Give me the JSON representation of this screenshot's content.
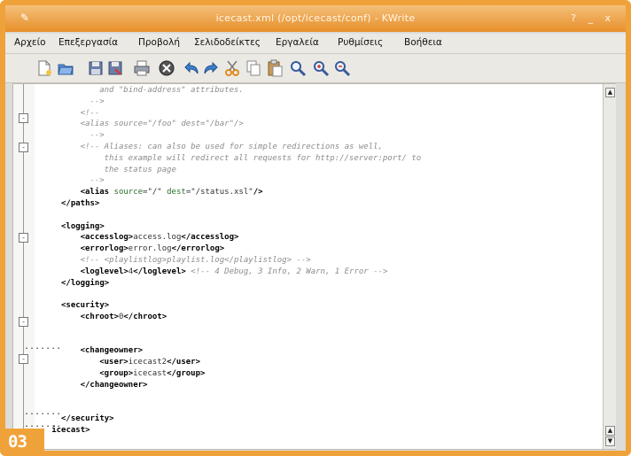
{
  "window": {
    "title": "icecast.xml (/opt/icecast/conf) - KWrite",
    "controls": "?  _  x"
  },
  "menubar": {
    "items": [
      "Αρχείο",
      "Επεξεργασία",
      "Προβολή",
      "Σελιδοδείκτες",
      "Εργαλεία",
      "Ρυθμίσεις",
      "Βοήθεια"
    ]
  },
  "toolbar": {
    "icons": [
      "new-file-icon",
      "open-file-icon",
      "save-icon",
      "save-as-icon",
      "print-icon",
      "close-icon",
      "undo-icon",
      "redo-icon",
      "cut-icon",
      "copy-icon",
      "paste-icon",
      "find-icon",
      "zoom-in-icon",
      "zoom-out-icon"
    ]
  },
  "editor": {
    "lines": [
      {
        "indent": 8,
        "parts": [
          {
            "k": "c",
            "t": "and \"bind-address\" attributes."
          }
        ]
      },
      {
        "indent": 6,
        "parts": [
          {
            "k": "c",
            "t": "-->"
          }
        ]
      },
      {
        "indent": 4,
        "parts": [
          {
            "k": "c",
            "t": "<!--"
          }
        ]
      },
      {
        "indent": 4,
        "parts": [
          {
            "k": "c",
            "t": "<alias source=\"/foo\" dest=\"/bar\"/>"
          }
        ]
      },
      {
        "indent": 6,
        "parts": [
          {
            "k": "c",
            "t": "-->"
          }
        ]
      },
      {
        "indent": 4,
        "parts": [
          {
            "k": "c",
            "t": "<!-- Aliases: can also be used for simple redirections as well,"
          }
        ]
      },
      {
        "indent": 9,
        "parts": [
          {
            "k": "c",
            "t": "this example will redirect all requests for http://server:port/ to"
          }
        ]
      },
      {
        "indent": 9,
        "parts": [
          {
            "k": "c",
            "t": "the status page"
          }
        ]
      },
      {
        "indent": 6,
        "parts": [
          {
            "k": "c",
            "t": "-->"
          }
        ]
      },
      {
        "indent": 4,
        "parts": [
          {
            "k": "t",
            "t": "<alias "
          },
          {
            "k": "a",
            "t": "source"
          },
          {
            "k": "v",
            "t": "=\"/\" "
          },
          {
            "k": "a",
            "t": "dest"
          },
          {
            "k": "v",
            "t": "=\"/status.xsl\""
          },
          {
            "k": "t",
            "t": "/>"
          }
        ]
      },
      {
        "indent": 0,
        "parts": [
          {
            "k": "t",
            "t": "</paths>"
          }
        ]
      },
      {
        "indent": 0,
        "parts": [
          {
            "k": "v",
            "t": ""
          }
        ]
      },
      {
        "indent": 0,
        "parts": [
          {
            "k": "t",
            "t": "<logging>"
          }
        ]
      },
      {
        "indent": 4,
        "parts": [
          {
            "k": "t",
            "t": "<accesslog>"
          },
          {
            "k": "v",
            "t": "access.log"
          },
          {
            "k": "t",
            "t": "</accesslog>"
          }
        ]
      },
      {
        "indent": 4,
        "parts": [
          {
            "k": "t",
            "t": "<errorlog>"
          },
          {
            "k": "v",
            "t": "error.log"
          },
          {
            "k": "t",
            "t": "</errorlog>"
          }
        ]
      },
      {
        "indent": 4,
        "parts": [
          {
            "k": "c",
            "t": "<!-- <playlistlog>playlist.log</playlistlog> -->"
          }
        ]
      },
      {
        "indent": 4,
        "parts": [
          {
            "k": "t",
            "t": "<loglevel>"
          },
          {
            "k": "v",
            "t": "4"
          },
          {
            "k": "t",
            "t": "</loglevel> "
          },
          {
            "k": "c",
            "t": "<!-- 4 Debug, 3 Info, 2 Warn, 1 Error -->"
          }
        ]
      },
      {
        "indent": 0,
        "parts": [
          {
            "k": "t",
            "t": "</logging>"
          }
        ]
      },
      {
        "indent": 0,
        "parts": [
          {
            "k": "v",
            "t": ""
          }
        ]
      },
      {
        "indent": 0,
        "parts": [
          {
            "k": "t",
            "t": "<security>"
          }
        ]
      },
      {
        "indent": 4,
        "parts": [
          {
            "k": "t",
            "t": "<chroot>"
          },
          {
            "k": "v",
            "t": "0"
          },
          {
            "k": "t",
            "t": "</chroot>"
          }
        ]
      },
      {
        "indent": 0,
        "parts": [
          {
            "k": "v",
            "t": ""
          }
        ]
      },
      {
        "indent": 0,
        "parts": [
          {
            "k": "v",
            "t": ""
          }
        ]
      },
      {
        "indent": 4,
        "parts": [
          {
            "k": "t",
            "t": "<changeowner>"
          }
        ]
      },
      {
        "indent": 8,
        "parts": [
          {
            "k": "t",
            "t": "<user>"
          },
          {
            "k": "v",
            "t": "icecast2"
          },
          {
            "k": "t",
            "t": "</user>"
          }
        ]
      },
      {
        "indent": 8,
        "parts": [
          {
            "k": "t",
            "t": "<group>"
          },
          {
            "k": "v",
            "t": "icecast"
          },
          {
            "k": "t",
            "t": "</group>"
          }
        ]
      },
      {
        "indent": 4,
        "parts": [
          {
            "k": "t",
            "t": "</changeowner>"
          }
        ]
      },
      {
        "indent": 0,
        "parts": [
          {
            "k": "v",
            "t": ""
          }
        ]
      },
      {
        "indent": 0,
        "parts": [
          {
            "k": "v",
            "t": ""
          }
        ]
      },
      {
        "indent": 0,
        "parts": [
          {
            "k": "t",
            "t": "</security>"
          }
        ]
      },
      {
        "indent": -2,
        "parts": [
          {
            "k": "t",
            "t": "icecast>"
          }
        ]
      }
    ],
    "fold_markers": [
      "-",
      "-",
      "-",
      "-",
      "-"
    ],
    "dotted_markers": [
      ".......",
      ".......",
      "......."
    ]
  },
  "scrollbar": {
    "up_arrow": "▲",
    "down_arrow": "▼"
  },
  "badge": {
    "label": "03"
  },
  "colors": {
    "accent": "#f0a23a",
    "comment": "#8c8c8c",
    "attribute": "#2b6e2b"
  }
}
